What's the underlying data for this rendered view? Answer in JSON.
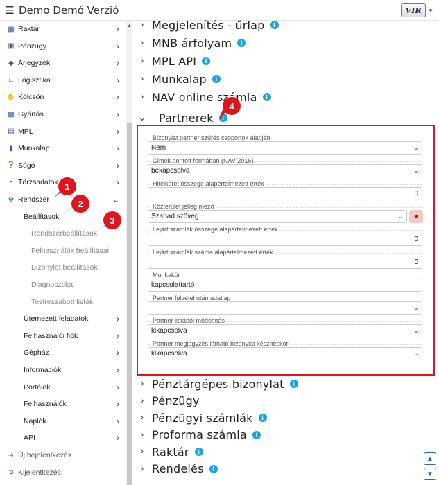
{
  "app": {
    "title": "Demo Demó Verzió",
    "logo_text": "VIR"
  },
  "sidebar": {
    "items": [
      {
        "label": "Raktár",
        "icon": "warehouse-icon"
      },
      {
        "label": "Pénzügy",
        "icon": "money-icon"
      },
      {
        "label": "Árjegyzék",
        "icon": "tag-icon"
      },
      {
        "label": "Logisztika",
        "icon": "dolly-icon"
      },
      {
        "label": "Kölcsön",
        "icon": "hand-icon"
      },
      {
        "label": "Gyártás",
        "icon": "cubes-icon"
      },
      {
        "label": "MPL",
        "icon": "truck-icon"
      },
      {
        "label": "Munkalap",
        "icon": "file-icon"
      },
      {
        "label": "Súgó",
        "icon": "question-icon"
      },
      {
        "label": "Törzsadatok",
        "icon": "database-icon"
      },
      {
        "label": "Rendszer",
        "icon": "gears-icon"
      }
    ],
    "rendszer_sub": [
      "Beállítások",
      "Rendszerbeállítások",
      "Felhasználók beállításai",
      "Bizonylat beállítások",
      "Diagnosztika",
      "Testreszabott listák",
      "Ütemezett feladatok",
      "Felhasználói fiók",
      "Gépház",
      "Információk",
      "Portálok",
      "Felhasználók",
      "Naplók",
      "API"
    ],
    "bottom": [
      {
        "label": "Új bejelentkezés",
        "icon": "login-icon"
      },
      {
        "label": "Kijelentkezés",
        "icon": "logout-icon"
      }
    ]
  },
  "sections_top": [
    "Megjelenítés - űrlap",
    "MNB árfolyam",
    "MPL API",
    "Munkalap",
    "NAV online számla"
  ],
  "open_section": "Partnerek",
  "fields": [
    {
      "label": "Bizonylat partner szűrés csoportok alapján",
      "value": "Nem",
      "kind": "select"
    },
    {
      "label": "Címek bontott formában (NAV 2016)",
      "value": "bekapcsolva",
      "kind": "select"
    },
    {
      "label": "Hitelkeret összege alapértelmezett érték",
      "value": "0",
      "kind": "number"
    },
    {
      "label": "Közterület jelleg mező",
      "value": "Szabad szöveg",
      "kind": "select-user"
    },
    {
      "label": "Lejárt számlák összege alapértelmezett érték",
      "value": "0",
      "kind": "number"
    },
    {
      "label": "Lejárt számlák száma alapértelmezett érték",
      "value": "0",
      "kind": "number"
    },
    {
      "label": "Munkakör",
      "value": "kapcsolattartó",
      "kind": "text"
    },
    {
      "label": "Partner felvétel után adatlap",
      "value": "",
      "kind": "select"
    },
    {
      "label": "Partner listából módosítás",
      "value": "kikapcsolva",
      "kind": "select"
    },
    {
      "label": "Partner megjegyzés látható bizonylat készítéskor",
      "value": "kikapcsolva",
      "kind": "select"
    }
  ],
  "sections_bottom": [
    {
      "label": "Pénztárgépes bizonylat",
      "info": true
    },
    {
      "label": "Pénzügy",
      "info": false
    },
    {
      "label": "Pénzügyi számlák",
      "info": true
    },
    {
      "label": "Proforma számla",
      "info": true
    },
    {
      "label": "Raktár",
      "info": true
    },
    {
      "label": "Rendelés",
      "info": true
    }
  ],
  "badges": [
    "1",
    "2",
    "3",
    "4"
  ],
  "colors": {
    "highlight": "#e0141e",
    "info": "#1aa3e8",
    "sidebar_icon": "#3b5b8c",
    "nav_button": "#2563c9"
  }
}
